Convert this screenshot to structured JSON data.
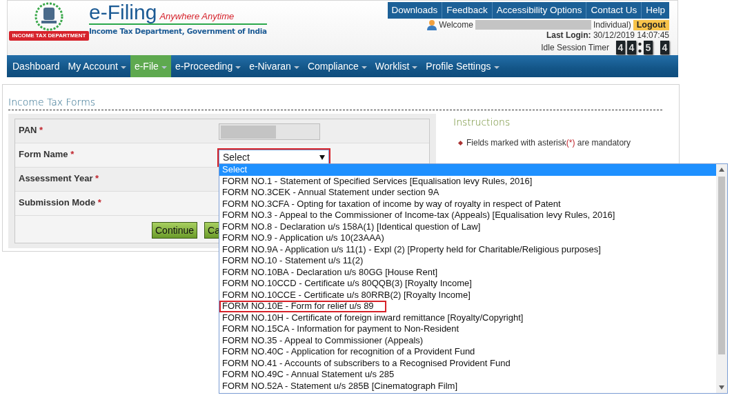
{
  "header": {
    "brand": "e-Filing",
    "tagline": "Anywhere Anytime",
    "department": "Income Tax Department, Government of India",
    "emblem_ribbon": "INCOME TAX DEPARTMENT"
  },
  "top_links": [
    "Downloads",
    "Feedback",
    "Accessibility Options",
    "Contact Us",
    "Help"
  ],
  "user": {
    "welcome": "Welcome",
    "account_suffix": "Individual)",
    "logout": "Logout",
    "last_login_label": "Last Login:",
    "last_login": "30/12/2019 14:07:45",
    "idle_timer_label": "Idle Session Timer",
    "timer_minutes": [
      "4",
      "4"
    ],
    "timer_seconds": [
      "5",
      "4"
    ]
  },
  "nav": [
    {
      "label": "Dashboard",
      "selected": false,
      "dropdown": false
    },
    {
      "label": "My Account",
      "selected": false,
      "dropdown": true
    },
    {
      "label": "e-File",
      "selected": true,
      "dropdown": true
    },
    {
      "label": "e-Proceeding",
      "selected": false,
      "dropdown": true
    },
    {
      "label": "e-Nivaran",
      "selected": false,
      "dropdown": true
    },
    {
      "label": "Compliance",
      "selected": false,
      "dropdown": true
    },
    {
      "label": "Worklist",
      "selected": false,
      "dropdown": true
    },
    {
      "label": "Profile Settings",
      "selected": false,
      "dropdown": true
    }
  ],
  "page": {
    "title": "Income Tax Forms",
    "fields": [
      {
        "label": "PAN",
        "required_mark": "*",
        "kind": "redacted"
      },
      {
        "label": "Form Name",
        "required_mark": "*",
        "kind": "select",
        "value": "Select",
        "highlighted": true,
        "expanded": true
      },
      {
        "label": "Assessment Year",
        "required_mark": "*",
        "kind": "covered"
      },
      {
        "label": "Submission Mode",
        "required_mark": "*",
        "kind": "covered"
      }
    ],
    "buttons": [
      "Continue",
      "Ca"
    ]
  },
  "instructions": {
    "title": "Instructions",
    "items": [
      {
        "before": "Fields marked with asterisk",
        "mark": "(*)",
        "after": " are mandatory"
      }
    ]
  },
  "dropdown": {
    "options": [
      {
        "label": "Select",
        "selected": true,
        "highlighted": false
      },
      {
        "label": "FORM NO.1 - Statement of Specified Services [Equalisation levy Rules, 2016]",
        "selected": false,
        "highlighted": false
      },
      {
        "label": "FORM NO.3CEK - Annual Statement under section 9A",
        "selected": false,
        "highlighted": false
      },
      {
        "label": "FORM NO.3CFA - Opting for taxation of income by way of royalty in respect of Patent",
        "selected": false,
        "highlighted": false
      },
      {
        "label": "FORM NO.3 - Appeal to the Commissioner of Income-tax (Appeals) [Equalisation levy Rules, 2016]",
        "selected": false,
        "highlighted": false
      },
      {
        "label": "FORM NO.8 - Declaration u/s 158A(1) [Identical question of Law]",
        "selected": false,
        "highlighted": false
      },
      {
        "label": "FORM NO.9 - Application u/s 10(23AAA)",
        "selected": false,
        "highlighted": false
      },
      {
        "label": "FORM NO.9A - Application u/s 11(1) - Expl (2) [Property held for Charitable/Religious purposes]",
        "selected": false,
        "highlighted": false
      },
      {
        "label": "FORM NO.10 - Statement u/s 11(2)",
        "selected": false,
        "highlighted": false
      },
      {
        "label": "FORM NO.10BA - Declaration u/s 80GG [House Rent]",
        "selected": false,
        "highlighted": false
      },
      {
        "label": "FORM NO.10CCD - Certificate u/s 80QQB(3) [Royalty Income]",
        "selected": false,
        "highlighted": false
      },
      {
        "label": "FORM NO.10CCE - Certificate u/s 80RRB(2) [Royalty Income]",
        "selected": false,
        "highlighted": false
      },
      {
        "label": "FORM NO.10E - Form for relief u/s 89",
        "selected": false,
        "highlighted": true
      },
      {
        "label": "FORM NO.10H - Certificate of foreign inward remittance [Royalty/Copyright]",
        "selected": false,
        "highlighted": false
      },
      {
        "label": "FORM NO.15CA - Information for payment to Non-Resident",
        "selected": false,
        "highlighted": false
      },
      {
        "label": "FORM NO.35 - Appeal to Commissioner (Appeals)",
        "selected": false,
        "highlighted": false
      },
      {
        "label": "FORM NO.40C - Application for recognition of a Provident Fund",
        "selected": false,
        "highlighted": false
      },
      {
        "label": "FORM NO.41 - Accounts of subscribers to a Recognised Provident Fund",
        "selected": false,
        "highlighted": false
      },
      {
        "label": "FORM NO.49C - Annual Statement u/s 285",
        "selected": false,
        "highlighted": false
      },
      {
        "label": "FORM NO.52A - Statement u/s 285B [Cinematograph Film]",
        "selected": false,
        "highlighted": false
      }
    ]
  }
}
